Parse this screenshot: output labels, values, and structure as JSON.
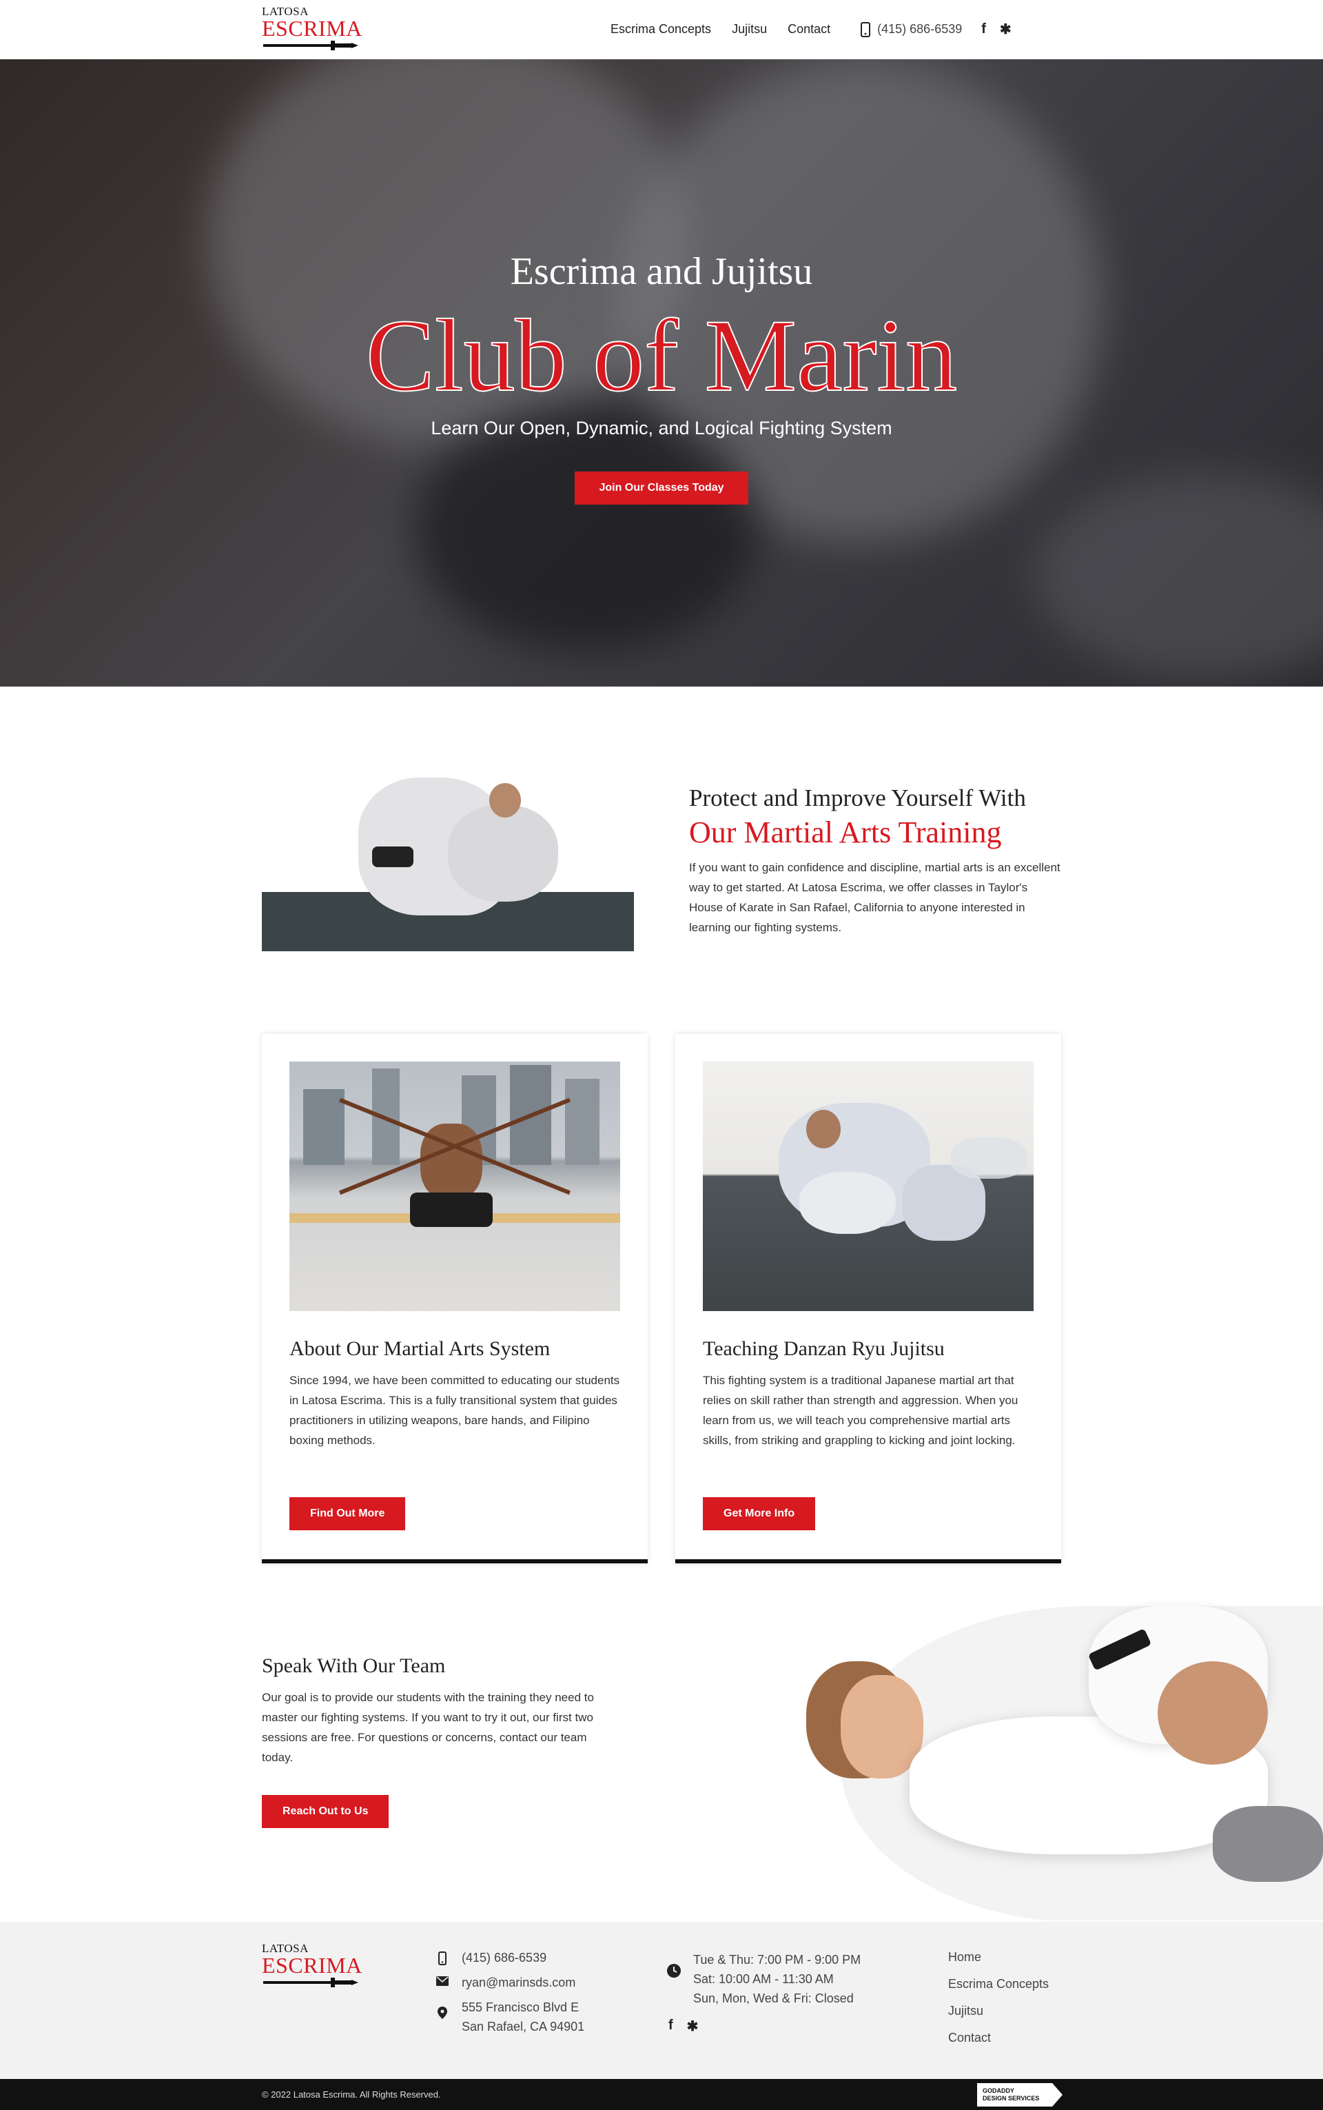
{
  "brand": {
    "logo_top": "LATOSA",
    "logo_main": "ESCRIMA",
    "accent": "#d71920"
  },
  "nav": {
    "items": [
      {
        "label": "Escrima Concepts"
      },
      {
        "label": "Jujitsu"
      },
      {
        "label": "Contact"
      }
    ],
    "phone": "(415) 686-6539",
    "social": [
      "facebook-icon",
      "yelp-icon"
    ]
  },
  "hero": {
    "subtitle": "Escrima and Jujitsu",
    "title": "Club of Marin",
    "tagline": "Learn Our Open, Dynamic, and Logical Fighting System",
    "cta": "Join Our Classes Today"
  },
  "intro": {
    "heading1": "Protect and Improve Yourself With",
    "heading2": "Our Martial Arts Training",
    "body": "If you want to gain confidence and discipline, martial arts is an excellent way to get started. At Latosa Escrima, we offer classes in Taylor's House of Karate in San Rafael, California to anyone interested in learning our fighting systems."
  },
  "cards": [
    {
      "title": "About Our Martial Arts System",
      "body": "Since 1994, we have been committed to educating our students in Latosa Escrima. This is a fully transitional system that guides practitioners in utilizing weapons, bare hands, and Filipino boxing methods.",
      "button": "Find Out More"
    },
    {
      "title": "Teaching Danzan Ryu Jujitsu",
      "body": "This fighting system is a traditional Japanese martial art that relies on skill rather than strength and aggression. When you learn from us, we will teach you comprehensive martial arts skills, from striking and grappling to kicking and joint locking.",
      "button": "Get More Info"
    }
  ],
  "speak": {
    "heading": "Speak With Our Team",
    "body": "Our goal is to provide our students with the training they need to master our fighting systems. If you want to try it out, our first two sessions are free. For questions or concerns, contact our team today.",
    "button": "Reach Out to Us"
  },
  "footer": {
    "phone": "(415) 686-6539",
    "email": "ryan@marinsds.com",
    "address_line1": "555 Francisco Blvd E",
    "address_line2": "San Rafael, CA 94901",
    "hours": [
      "Tue & Thu: 7:00 PM - 9:00 PM",
      "Sat: 10:00 AM - 11:30 AM",
      "Sun, Mon, Wed & Fri: Closed"
    ],
    "links": [
      "Home",
      "Escrima Concepts",
      "Jujitsu",
      "Contact"
    ],
    "copyright": "© 2022 Latosa Escrima. All Rights Reserved.",
    "badge_line1": "GODADDY",
    "badge_line2": "DESIGN SERVICES"
  }
}
